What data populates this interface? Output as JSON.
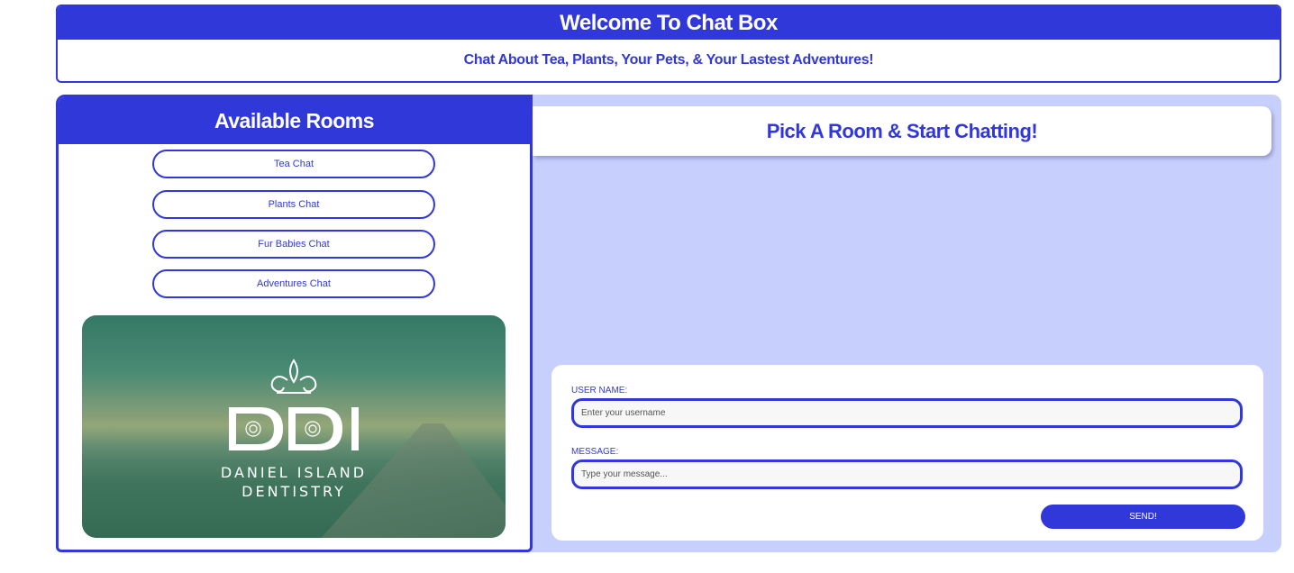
{
  "header": {
    "title": "Welcome To Chat Box",
    "subtitle": "Chat About Tea, Plants, Your Pets, & Your Lastest Adventures!"
  },
  "rooms": {
    "title": "Available Rooms",
    "items": [
      {
        "label": "Tea Chat"
      },
      {
        "label": "Plants Chat"
      },
      {
        "label": "Fur Babies Chat"
      },
      {
        "label": "Adventures Chat"
      }
    ],
    "logo": {
      "line1": "DANIEL ISLAND",
      "line2": "DENTISTRY"
    }
  },
  "chat": {
    "title": "Pick A Room & Start Chatting!",
    "username_label": "USER NAME:",
    "username_placeholder": "Enter your username",
    "message_label": "MESSAGE:",
    "message_placeholder": "Type your message...",
    "send_label": "SEND!"
  },
  "colors": {
    "primary": "#3138d9",
    "panel_bg": "#c7cffc",
    "input_bg": "#f7f7f7"
  }
}
